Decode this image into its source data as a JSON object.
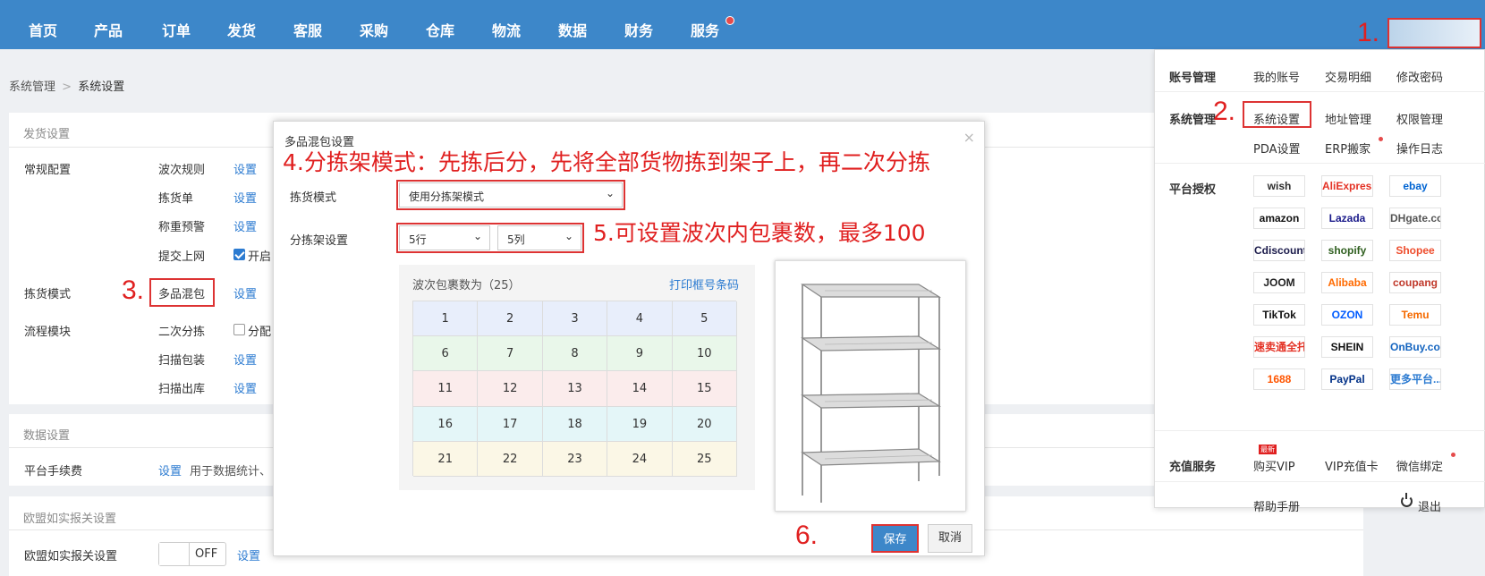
{
  "nav": {
    "items": [
      "首页",
      "产品",
      "订单",
      "发货",
      "客服",
      "采购",
      "仓库",
      "物流",
      "数据",
      "财务",
      "服务"
    ],
    "accent": "#3d87c9"
  },
  "steps": {
    "s1": "1.",
    "s2": "2.",
    "s3": "3.",
    "s6": "6."
  },
  "breadcrumb": {
    "parent": "系统管理",
    "sep": ">",
    "current": "系统设置"
  },
  "ship_settings": {
    "title": "发货设置",
    "general": {
      "label": "常规配置",
      "rows": [
        {
          "label": "波次规则",
          "action": "设置"
        },
        {
          "label": "拣货单",
          "action": "设置"
        },
        {
          "label": "称重预警",
          "action": "设置"
        },
        {
          "label": "提交上网",
          "checkbox_label": "开启"
        }
      ]
    },
    "pick_mode": {
      "label": "拣货模式",
      "value": "多品混包",
      "action": "设置"
    },
    "flow": {
      "label": "流程模块",
      "rows": [
        {
          "label": "二次分拣",
          "checkbox_label": "分配"
        },
        {
          "label": "扫描包装",
          "action": "设置"
        },
        {
          "label": "扫描出库",
          "action": "设置"
        }
      ]
    }
  },
  "data_settings": {
    "title": "数据设置",
    "fee_label": "平台手续费",
    "fee_action": "设置",
    "fee_desc": "用于数据统计、"
  },
  "eu_settings": {
    "title": "欧盟如实报关设置",
    "row_label": "欧盟如实报关设置",
    "toggle": "OFF",
    "action": "设置"
  },
  "modal": {
    "title": "多品混包设置",
    "close": "×",
    "annotation_4": "4.分拣架模式：先拣后分，先将全部货物拣到架子上，再二次分拣",
    "annotation_5": "5.可设置波次内包裹数，最多100",
    "pick_mode_label": "拣货模式",
    "pick_mode_value": "使用分拣架模式",
    "shelf_label": "分拣架设置",
    "rows_value": "5行",
    "cols_value": "5列",
    "wave_count_label": "波次包裹数为（25）",
    "print_label": "打印框号条码",
    "grid": [
      [
        "1",
        "2",
        "3",
        "4",
        "5"
      ],
      [
        "6",
        "7",
        "8",
        "9",
        "10"
      ],
      [
        "11",
        "12",
        "13",
        "14",
        "15"
      ],
      [
        "16",
        "17",
        "18",
        "19",
        "20"
      ],
      [
        "21",
        "22",
        "23",
        "24",
        "25"
      ]
    ],
    "row_colors": [
      "#e8eefb",
      "#e9f7ea",
      "#fbecec",
      "#e4f6f8",
      "#fbf7e6"
    ],
    "save": "保存",
    "cancel": "取消"
  },
  "dropdown": {
    "account": {
      "label": "账号管理",
      "items": [
        "我的账号",
        "交易明细",
        "修改密码"
      ]
    },
    "system": {
      "label": "系统管理",
      "items": [
        "系统设置",
        "地址管理",
        "权限管理",
        "PDA设置",
        "ERP搬家",
        "操作日志"
      ]
    },
    "platforms": {
      "label": "平台授权",
      "items": [
        {
          "name": "wish",
          "color": "#2f2f2f"
        },
        {
          "name": "AliExpress",
          "color": "#e43225"
        },
        {
          "name": "ebay",
          "color": "#0064d2"
        },
        {
          "name": "amazon",
          "color": "#111111"
        },
        {
          "name": "Lazada",
          "color": "#1a1a8a"
        },
        {
          "name": "DHgate.com",
          "color": "#555555"
        },
        {
          "name": "Cdiscount",
          "color": "#1a1a4a"
        },
        {
          "name": "shopify",
          "color": "#2f5f1f"
        },
        {
          "name": "Shopee",
          "color": "#ee4d2d"
        },
        {
          "name": "JOOM",
          "color": "#222222"
        },
        {
          "name": "Alibaba",
          "color": "#ff6a00"
        },
        {
          "name": "coupang",
          "color": "#c0392b"
        },
        {
          "name": "TikTok",
          "color": "#111111"
        },
        {
          "name": "OZON",
          "color": "#005bff"
        },
        {
          "name": "Temu",
          "color": "#f56a00"
        },
        {
          "name": "速卖通全托管",
          "color": "#e43225"
        },
        {
          "name": "SHEIN",
          "color": "#111111"
        },
        {
          "name": "OnBuy.com",
          "color": "#1565c0"
        },
        {
          "name": "1688",
          "color": "#ff5500"
        },
        {
          "name": "PayPal",
          "color": "#003087"
        },
        {
          "name": "更多平台...",
          "color": "#2c7bd1"
        }
      ]
    },
    "recharge": {
      "label": "充值服务",
      "items": [
        "购买VIP",
        "VIP充值卡",
        "微信绑定"
      ],
      "badge": "最新"
    },
    "help": "帮助手册",
    "logout": "退出"
  }
}
